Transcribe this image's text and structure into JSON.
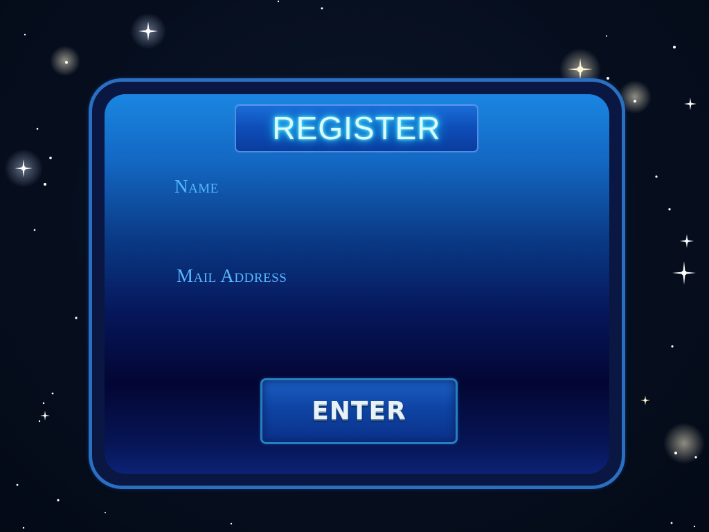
{
  "screen": {
    "title": "REGISTER",
    "background_color": "#050d1c",
    "accent_color": "#2b6fc0"
  },
  "form": {
    "name_label": "Name",
    "name_value": "",
    "mail_label": "Mail Address",
    "mail_value": ""
  },
  "actions": {
    "enter_label": "ENTER"
  }
}
